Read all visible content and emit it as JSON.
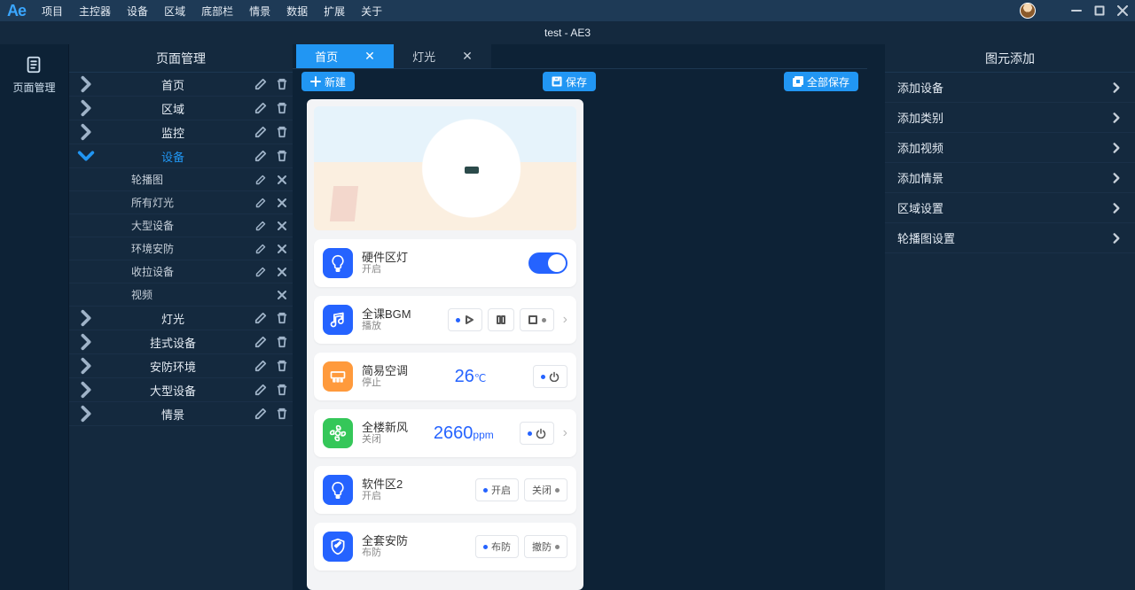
{
  "app": {
    "logo": "Ae",
    "title": "test  -  AE3"
  },
  "menu": [
    "项目",
    "主控器",
    "设备",
    "区域",
    "底部栏",
    "情景",
    "数据",
    "扩展",
    "关于"
  ],
  "leftrail": {
    "label": "页面管理"
  },
  "leftpanel": {
    "title": "页面管理",
    "rows": [
      {
        "label": "首页",
        "expanded": false,
        "active": false,
        "children": []
      },
      {
        "label": "区域",
        "expanded": false,
        "active": false,
        "children": []
      },
      {
        "label": "监控",
        "expanded": false,
        "active": false,
        "children": []
      },
      {
        "label": "设备",
        "expanded": true,
        "active": true,
        "children": [
          {
            "label": "轮播图"
          },
          {
            "label": "所有灯光"
          },
          {
            "label": "大型设备"
          },
          {
            "label": "环境安防"
          },
          {
            "label": "收拉设备"
          },
          {
            "label": "视频",
            "noedit": true
          }
        ]
      },
      {
        "label": "灯光",
        "expanded": false,
        "active": false,
        "children": []
      },
      {
        "label": "挂式设备",
        "expanded": false,
        "active": false,
        "children": []
      },
      {
        "label": "安防环境",
        "expanded": false,
        "active": false,
        "children": []
      },
      {
        "label": "大型设备",
        "expanded": false,
        "active": false,
        "children": []
      },
      {
        "label": "情景",
        "expanded": false,
        "active": false,
        "children": []
      }
    ]
  },
  "tabs": [
    {
      "label": "首页",
      "active": true
    },
    {
      "label": "灯光",
      "active": false
    }
  ],
  "toolbar": {
    "new": "新建",
    "save": "保存",
    "saveall": "全部保存"
  },
  "cards": [
    {
      "icon": "bulb",
      "iconbg": "#2563ff",
      "title": "硬件区灯",
      "sub": "开启",
      "widget": "switch"
    },
    {
      "icon": "music",
      "iconbg": "#2563ff",
      "title": "全课BGM",
      "sub": "播放",
      "widget": "media",
      "chev": true
    },
    {
      "icon": "ac",
      "iconbg": "#ff9a3c",
      "title": "简易空调",
      "sub": "停止",
      "widget": "temp",
      "value": "26",
      "unit": "℃"
    },
    {
      "icon": "fan",
      "iconbg": "#35c759",
      "title": "全楼新风",
      "sub": "关闭",
      "widget": "ppm",
      "value": "2660",
      "unit": "ppm",
      "chev": true
    },
    {
      "icon": "bulb",
      "iconbg": "#2563ff",
      "title": "软件区2",
      "sub": "开启",
      "widget": "onoff",
      "b1": "开启",
      "b2": "关闭"
    },
    {
      "icon": "shield",
      "iconbg": "#2563ff",
      "title": "全套安防",
      "sub": "布防",
      "widget": "onoff",
      "b1": "布防",
      "b2": "撤防"
    }
  ],
  "rightpanel": {
    "title": "图元添加",
    "items": [
      "添加设备",
      "添加类别",
      "添加视频",
      "添加情景",
      "区域设置",
      "轮播图设置"
    ]
  }
}
